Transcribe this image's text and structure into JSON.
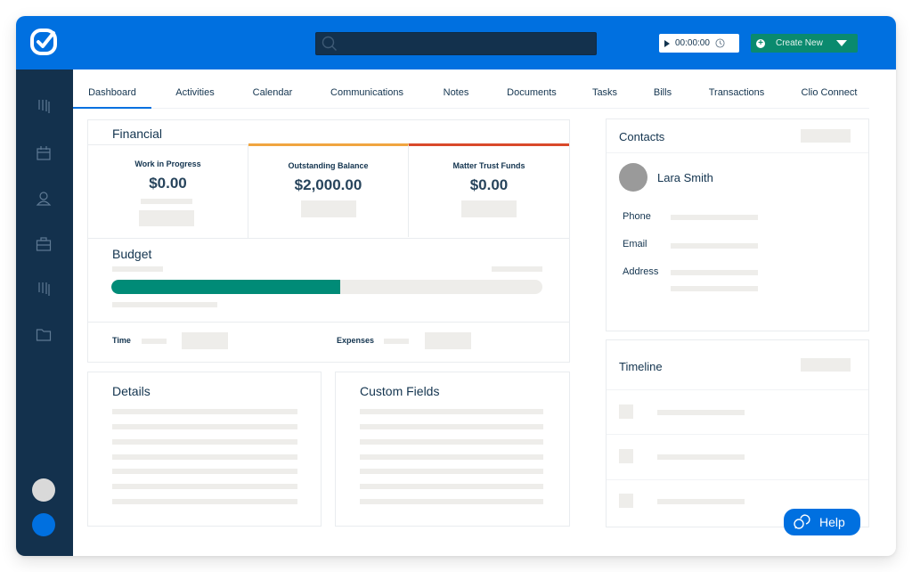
{
  "topbar": {
    "logo_icon": "clio-check-logo-icon",
    "search": {
      "placeholder": "",
      "value": "",
      "icon": "search-icon"
    },
    "timer": {
      "value": "00:00:00",
      "play_icon": "play-icon",
      "clock_icon": "clock-icon"
    },
    "create_new": {
      "label": "Create New",
      "icon": "plus-circle-icon",
      "caret_icon": "caret-down-icon"
    }
  },
  "sidebar": {
    "items": [
      {
        "icon": "activities-icon"
      },
      {
        "icon": "calendar-icon"
      },
      {
        "icon": "contacts-icon"
      },
      {
        "icon": "matters-briefcase-icon"
      },
      {
        "icon": "billing-icon"
      },
      {
        "icon": "documents-folder-icon"
      }
    ],
    "bottom": [
      {
        "name": "user-avatar",
        "color": "#d9d9d9"
      },
      {
        "name": "status-dot",
        "color": "#0070e0"
      }
    ]
  },
  "tabs": [
    {
      "label": "Dashboard",
      "active": true
    },
    {
      "label": "Activities"
    },
    {
      "label": "Calendar"
    },
    {
      "label": "Communications"
    },
    {
      "label": "Notes"
    },
    {
      "label": "Documents"
    },
    {
      "label": "Tasks"
    },
    {
      "label": "Bills"
    },
    {
      "label": "Transactions"
    },
    {
      "label": "Clio Connect"
    }
  ],
  "financial": {
    "title": "Financial",
    "cells": [
      {
        "label": "Work in Progress",
        "value": "$0.00",
        "accent": null
      },
      {
        "label": "Outstanding Balance",
        "value": "$2,000.00",
        "accent": "#f0a540"
      },
      {
        "label": "Matter Trust Funds",
        "value": "$0.00",
        "accent": "#d9492a"
      }
    ]
  },
  "budget": {
    "title": "Budget",
    "progress_fraction": 0.53,
    "progress_color": "#008b77",
    "time_label": "Time",
    "expenses_label": "Expenses"
  },
  "details": {
    "title": "Details"
  },
  "custom_fields": {
    "title": "Custom Fields"
  },
  "contacts": {
    "title": "Contacts",
    "name": "Lara Smith",
    "fields": [
      {
        "label": "Phone"
      },
      {
        "label": "Email"
      },
      {
        "label": "Address"
      }
    ]
  },
  "timeline": {
    "title": "Timeline"
  },
  "help": {
    "label": "Help",
    "icon": "chat-bubbles-icon"
  },
  "colors": {
    "brand_blue": "#0070e0",
    "navy": "#13314d",
    "green": "#0a8a6e"
  }
}
